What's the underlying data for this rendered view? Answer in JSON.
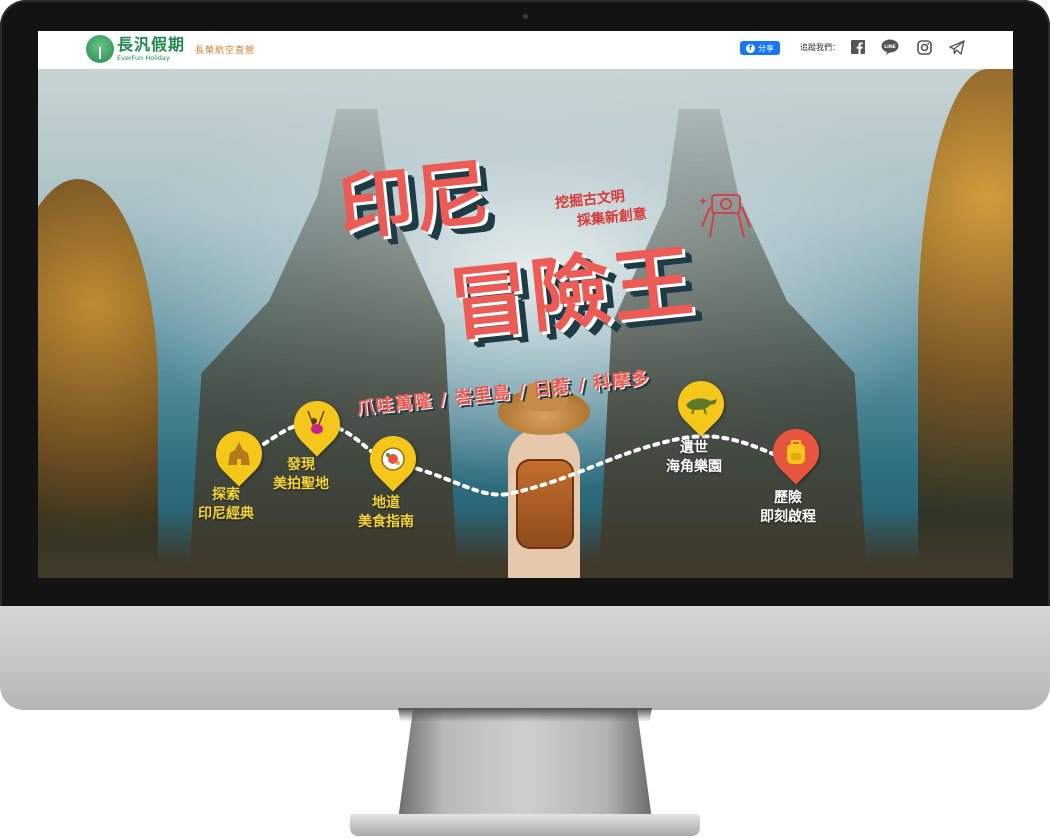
{
  "header": {
    "logo_cn": "長汎假期",
    "logo_en": "EverFun Holiday",
    "logo_tag": "長榮航空直營",
    "share_label": "分享",
    "follow_label": "追蹤我們：",
    "social_icons": [
      "facebook-icon",
      "line-icon",
      "instagram-icon",
      "telegram-icon"
    ]
  },
  "hero": {
    "title_line1": "印尼",
    "title_line2": "冒險王",
    "slogan_line1": "挖掘古文明",
    "slogan_line2": "採集新創意",
    "cities": "爪哇萬隆 / 峇里島 / 日惹 / 科摩多"
  },
  "stops": [
    {
      "line1": "探索",
      "line2": "印尼經典",
      "icon": "temple-icon"
    },
    {
      "line1": "發現",
      "line2": "美拍聖地",
      "icon": "swing-icon"
    },
    {
      "line1": "地道",
      "line2": "美食指南",
      "icon": "food-plate-icon"
    },
    {
      "line1": "遺世",
      "line2": "海角樂園",
      "icon": "komodo-dragon-icon"
    },
    {
      "line1": "歷險",
      "line2": "即刻啟程",
      "icon": "backpack-icon"
    }
  ],
  "colors": {
    "title_red": "#ec5b55",
    "shadow_teal": "#1f3b45",
    "pin_yellow": "#f6c71b",
    "pin_red": "#e8553f",
    "brand_green": "#1f8a4c",
    "brand_orange": "#d8782b",
    "facebook_blue": "#1877f2"
  }
}
